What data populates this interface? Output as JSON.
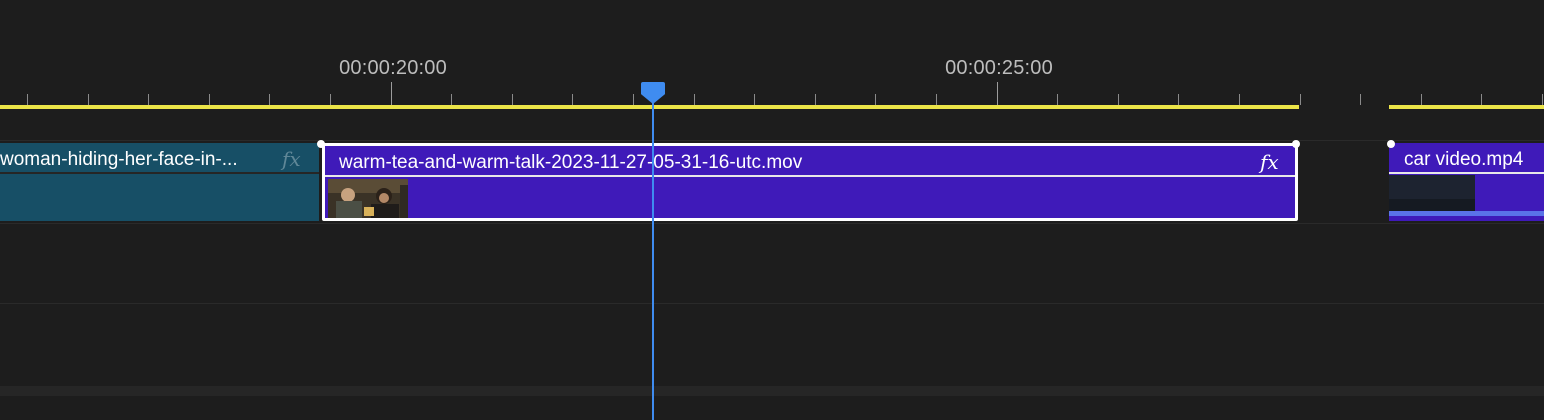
{
  "ruler": {
    "timecodes": [
      "00:00:20:00",
      "00:00:25:00"
    ]
  },
  "playhead": {
    "icon": "playhead-icon",
    "color": "#3f8cf0"
  },
  "work_area": {
    "color": "#ebe448"
  },
  "clips": {
    "previous": {
      "name": "woman-hiding-her-face-in-...",
      "fx": "fx",
      "color": "#174f66"
    },
    "current": {
      "name": "warm-tea-and-warm-talk-2023-11-27-05-31-16-utc.mov",
      "fx": "fx",
      "color": "#3f1ab9",
      "selected": true
    },
    "next": {
      "name": "car video.mp4",
      "color": "#3f1ab9"
    }
  }
}
